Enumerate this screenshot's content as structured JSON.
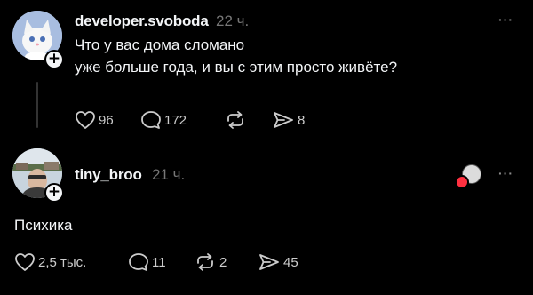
{
  "posts": [
    {
      "username": "developer.svoboda",
      "time": "22 ч.",
      "text": "Что у вас дома сломано\nуже больше года, и вы с этим просто живёте?",
      "likes": "96",
      "comments": "172",
      "reposts": "",
      "shares": "8",
      "avatar_icon": "white-kitten-avatar"
    },
    {
      "username": "tiny_broo",
      "time": "21 ч.",
      "text": "Психика",
      "likes": "2,5 тыс.",
      "comments": "11",
      "reposts": "2",
      "shares": "45",
      "avatar_icon": "person-photo-avatar"
    }
  ],
  "icons": {
    "like": "heart-icon",
    "comment": "comment-bubble-icon",
    "repost": "repost-arrows-icon",
    "share": "send-arrow-icon",
    "more": "more-dots-icon",
    "follow": "plus-icon"
  },
  "colors": {
    "background": "#000000",
    "text": "#f3f5f7",
    "muted": "#777777",
    "heart_badge": "#ff3040"
  }
}
